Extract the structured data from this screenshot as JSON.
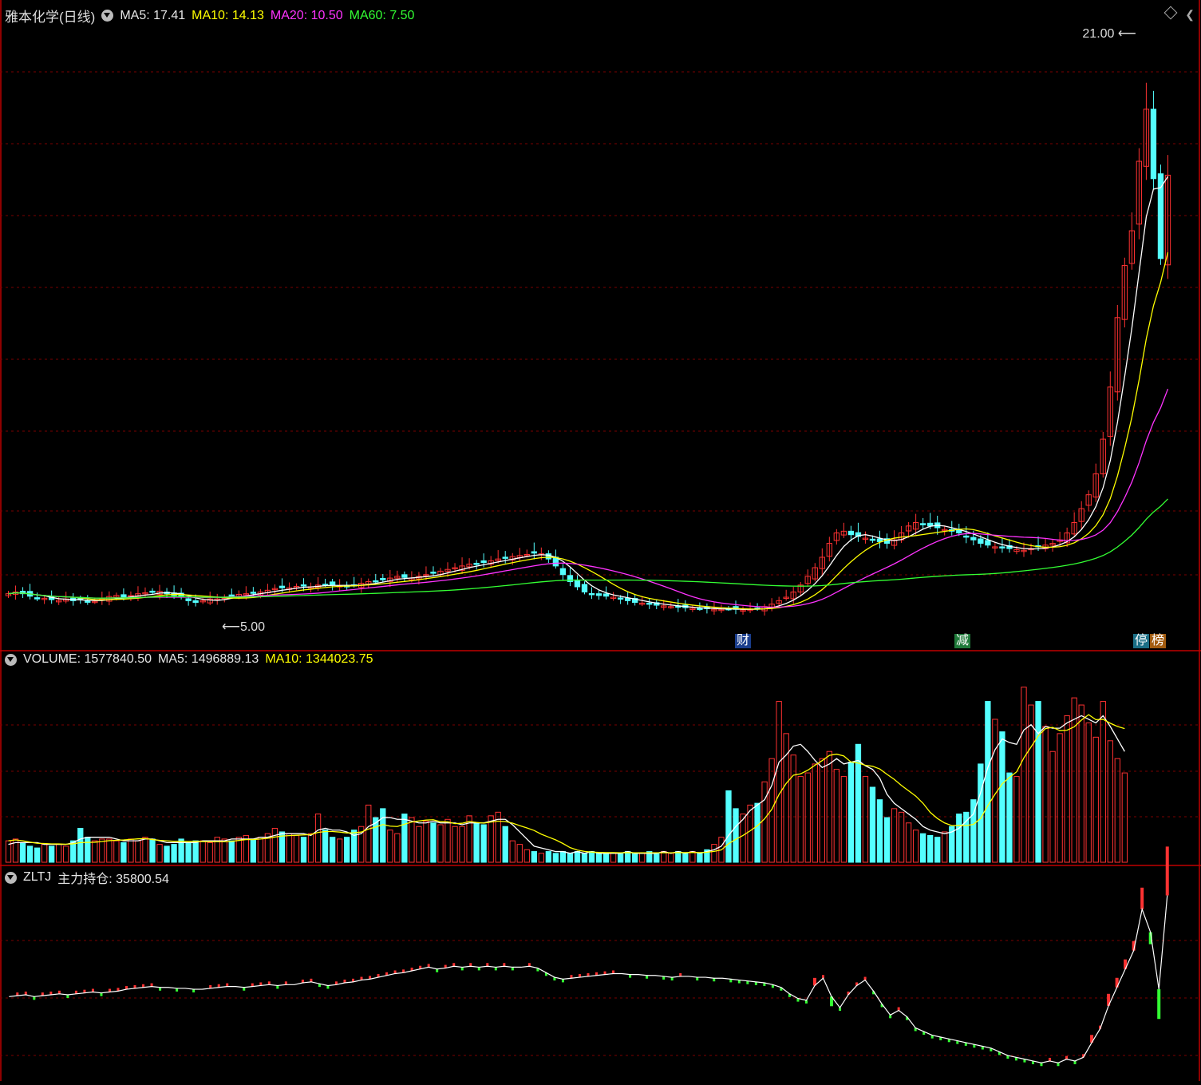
{
  "stock": {
    "title": "雅本化学(日线)",
    "ma5_label": "MA5: 17.41",
    "ma10_label": "MA10: 14.13",
    "ma20_label": "MA20: 10.50",
    "ma60_label": "MA60: 7.50"
  },
  "volume_panel": {
    "volume_label": "VOLUME: 1577840.50",
    "ma5_label": "MA5: 1496889.13",
    "ma10_label": "MA10: 1344023.75"
  },
  "zltj_panel": {
    "name": "ZLTJ",
    "holding_label": "主力持仓: 35800.54"
  },
  "events": [
    {
      "label": "财",
      "bg": "#1a3d8c"
    },
    {
      "label": "减",
      "bg": "#1f7a3a"
    },
    {
      "label": "停",
      "bg": "#1b6f86"
    },
    {
      "label": "榜",
      "bg": "#a25c10"
    }
  ],
  "colors": {
    "up": "#ff3232",
    "down": "#54ffff",
    "ma5": "#ffffff",
    "ma10": "#ffff00",
    "ma20": "#ff33ff",
    "ma60": "#33ff33",
    "grid": "#7a0000",
    "axis": "#c00000"
  },
  "chart_data": {
    "type": "candlestick",
    "title": "雅本化学(日线)",
    "high_marker": "21.00",
    "low_marker": "5.00",
    "price_range": [
      4.6,
      22.0
    ],
    "closes": [
      5.55,
      5.6,
      5.55,
      5.48,
      5.4,
      5.42,
      5.38,
      5.36,
      5.4,
      5.35,
      5.38,
      5.32,
      5.33,
      5.4,
      5.47,
      5.5,
      5.42,
      5.5,
      5.55,
      5.58,
      5.6,
      5.62,
      5.55,
      5.5,
      5.45,
      5.35,
      5.3,
      5.35,
      5.4,
      5.4,
      5.45,
      5.5,
      5.53,
      5.55,
      5.58,
      5.6,
      5.65,
      5.7,
      5.72,
      5.72,
      5.76,
      5.78,
      5.75,
      5.8,
      5.82,
      5.8,
      5.78,
      5.76,
      5.8,
      5.85,
      5.9,
      5.92,
      5.95,
      6.0,
      6.05,
      6.02,
      6.0,
      6.05,
      6.1,
      6.15,
      6.2,
      6.25,
      6.3,
      6.35,
      6.4,
      6.42,
      6.45,
      6.5,
      6.55,
      6.6,
      6.62,
      6.65,
      6.68,
      6.72,
      6.7,
      6.55,
      6.35,
      6.1,
      5.9,
      5.75,
      5.6,
      5.55,
      5.5,
      5.48,
      5.45,
      5.4,
      5.35,
      5.3,
      5.28,
      5.25,
      5.22,
      5.2,
      5.18,
      5.16,
      5.15,
      5.13,
      5.12,
      5.12,
      5.1,
      5.1,
      5.12,
      5.1,
      5.08,
      5.1,
      5.12,
      5.18,
      5.25,
      5.35,
      5.45,
      5.6,
      5.8,
      6.05,
      6.3,
      6.6,
      7.0,
      7.3,
      7.35,
      7.25,
      7.2,
      7.15,
      7.1,
      7.05,
      7.0,
      7.1,
      7.3,
      7.5,
      7.6,
      7.55,
      7.5,
      7.45,
      7.4,
      7.35,
      7.3,
      7.2,
      7.1,
      7.0,
      6.95,
      6.9,
      6.88,
      6.85,
      6.82,
      6.8,
      6.85,
      6.9,
      6.95,
      7.0,
      7.1,
      7.3,
      7.6,
      8.0,
      8.4,
      9.0,
      10.0,
      11.5,
      13.5,
      15.0,
      16.0,
      18.0,
      19.5,
      17.5,
      15.2,
      17.6
    ],
    "volumes": [
      0.12,
      0.13,
      0.11,
      0.09,
      0.08,
      0.1,
      0.09,
      0.1,
      0.09,
      0.12,
      0.19,
      0.14,
      0.12,
      0.13,
      0.13,
      0.12,
      0.11,
      0.13,
      0.12,
      0.14,
      0.13,
      0.1,
      0.09,
      0.1,
      0.13,
      0.11,
      0.12,
      0.12,
      0.11,
      0.14,
      0.13,
      0.12,
      0.14,
      0.15,
      0.13,
      0.14,
      0.16,
      0.19,
      0.17,
      0.16,
      0.15,
      0.14,
      0.16,
      0.27,
      0.18,
      0.14,
      0.13,
      0.14,
      0.18,
      0.2,
      0.32,
      0.25,
      0.3,
      0.18,
      0.16,
      0.27,
      0.25,
      0.2,
      0.23,
      0.22,
      0.21,
      0.24,
      0.2,
      0.2,
      0.26,
      0.22,
      0.21,
      0.26,
      0.28,
      0.2,
      0.12,
      0.1,
      0.07,
      0.06,
      0.05,
      0.06,
      0.05,
      0.06,
      0.05,
      0.06,
      0.05,
      0.06,
      0.05,
      0.05,
      0.05,
      0.05,
      0.06,
      0.05,
      0.05,
      0.06,
      0.05,
      0.06,
      0.05,
      0.06,
      0.05,
      0.06,
      0.05,
      0.07,
      0.1,
      0.14,
      0.4,
      0.3,
      0.27,
      0.32,
      0.33,
      0.45,
      0.58,
      0.9,
      0.72,
      0.6,
      0.48,
      0.5,
      0.55,
      0.58,
      0.62,
      0.52,
      0.48,
      0.56,
      0.66,
      0.48,
      0.42,
      0.35,
      0.25,
      0.3,
      0.28,
      0.22,
      0.18,
      0.16,
      0.15,
      0.14,
      0.17,
      0.2,
      0.27,
      0.28,
      0.35,
      0.55,
      0.9,
      0.8,
      0.73,
      0.5,
      0.48,
      0.98,
      0.88,
      0.9,
      0.76,
      0.62,
      0.72,
      0.82,
      0.92,
      0.88,
      0.78,
      0.7,
      0.9,
      0.68,
      0.58,
      0.5
    ],
    "holding": [
      35.0,
      35.1,
      35.2,
      35.0,
      35.1,
      35.2,
      35.3,
      35.2,
      35.3,
      35.4,
      35.5,
      35.4,
      35.5,
      35.6,
      35.8,
      35.9,
      36.0,
      36.1,
      36.0,
      36.0,
      35.9,
      35.9,
      35.8,
      35.8,
      35.9,
      36.0,
      36.1,
      36.1,
      36.0,
      36.1,
      36.2,
      36.3,
      36.2,
      36.3,
      36.3,
      36.5,
      36.6,
      36.4,
      36.2,
      36.3,
      36.5,
      36.6,
      36.8,
      36.9,
      37.1,
      37.3,
      37.5,
      37.6,
      37.8,
      38.0,
      38.2,
      38.0,
      38.1,
      38.3,
      38.2,
      38.3,
      38.2,
      38.3,
      38.2,
      38.3,
      38.2,
      38.2,
      38.3,
      38.1,
      37.6,
      37.1,
      36.9,
      37.0,
      37.1,
      37.2,
      37.3,
      37.4,
      37.5,
      37.5,
      37.4,
      37.4,
      37.3,
      37.3,
      37.2,
      37.1,
      37.2,
      37.2,
      37.1,
      37.1,
      37.0,
      37.0,
      36.9,
      36.8,
      36.7,
      36.6,
      36.5,
      36.3,
      36.0,
      35.3,
      34.8,
      34.6,
      36.2,
      37.0,
      35.0,
      33.8,
      35.2,
      36.2,
      36.8,
      35.6,
      34.2,
      33.0,
      33.5,
      32.8,
      31.6,
      31.2,
      30.8,
      30.6,
      30.4,
      30.2,
      30.0,
      29.8,
      29.6,
      29.4,
      29.0,
      28.6,
      28.4,
      28.2,
      28.0,
      27.8,
      28.0,
      27.8,
      28.2,
      28.0,
      28.4,
      30.0,
      31.5,
      34.0,
      36.0,
      38.0,
      40.0,
      44.5,
      42.0,
      35.8,
      46.0
    ],
    "volume_ma5": [
      0.1,
      0.11,
      0.11,
      0.11,
      0.11,
      0.1,
      0.1,
      0.1,
      0.1,
      0.11,
      0.13,
      0.14,
      0.14,
      0.14,
      0.14,
      0.13,
      0.12,
      0.12,
      0.12,
      0.13,
      0.13,
      0.12,
      0.11,
      0.11,
      0.11,
      0.11,
      0.11,
      0.12,
      0.12,
      0.12,
      0.12,
      0.13,
      0.13,
      0.13,
      0.13,
      0.14,
      0.14,
      0.15,
      0.16,
      0.16,
      0.16,
      0.16,
      0.15,
      0.18,
      0.19,
      0.18,
      0.18,
      0.17,
      0.15,
      0.16,
      0.2,
      0.22,
      0.25,
      0.25,
      0.24,
      0.24,
      0.23,
      0.22,
      0.22,
      0.23,
      0.22,
      0.22,
      0.22,
      0.21,
      0.22,
      0.22,
      0.22,
      0.23,
      0.24,
      0.24,
      0.21,
      0.17,
      0.13,
      0.09,
      0.08,
      0.07,
      0.06,
      0.06,
      0.05,
      0.06,
      0.05,
      0.06,
      0.05,
      0.05,
      0.05,
      0.05,
      0.06,
      0.05,
      0.05,
      0.05,
      0.05,
      0.06,
      0.05,
      0.06,
      0.05,
      0.06,
      0.05,
      0.06,
      0.07,
      0.09,
      0.15,
      0.2,
      0.24,
      0.29,
      0.32,
      0.35,
      0.43,
      0.56,
      0.6,
      0.65,
      0.66,
      0.62,
      0.57,
      0.53,
      0.55,
      0.58,
      0.55,
      0.56,
      0.57,
      0.54,
      0.52,
      0.47,
      0.38,
      0.33,
      0.3,
      0.27,
      0.24,
      0.2,
      0.18,
      0.17,
      0.16,
      0.17,
      0.19,
      0.23,
      0.27,
      0.39,
      0.53,
      0.63,
      0.69,
      0.67,
      0.66,
      0.74,
      0.77,
      0.72,
      0.76,
      0.75,
      0.75,
      0.78,
      0.8,
      0.82,
      0.8,
      0.78,
      0.82,
      0.76,
      0.69,
      0.62
    ],
    "series": [
      {
        "name": "MA5",
        "color": "#ffffff"
      },
      {
        "name": "MA10",
        "color": "#ffff00"
      },
      {
        "name": "MA20",
        "color": "#ff33ff"
      },
      {
        "name": "MA60",
        "color": "#33ff33"
      }
    ]
  }
}
